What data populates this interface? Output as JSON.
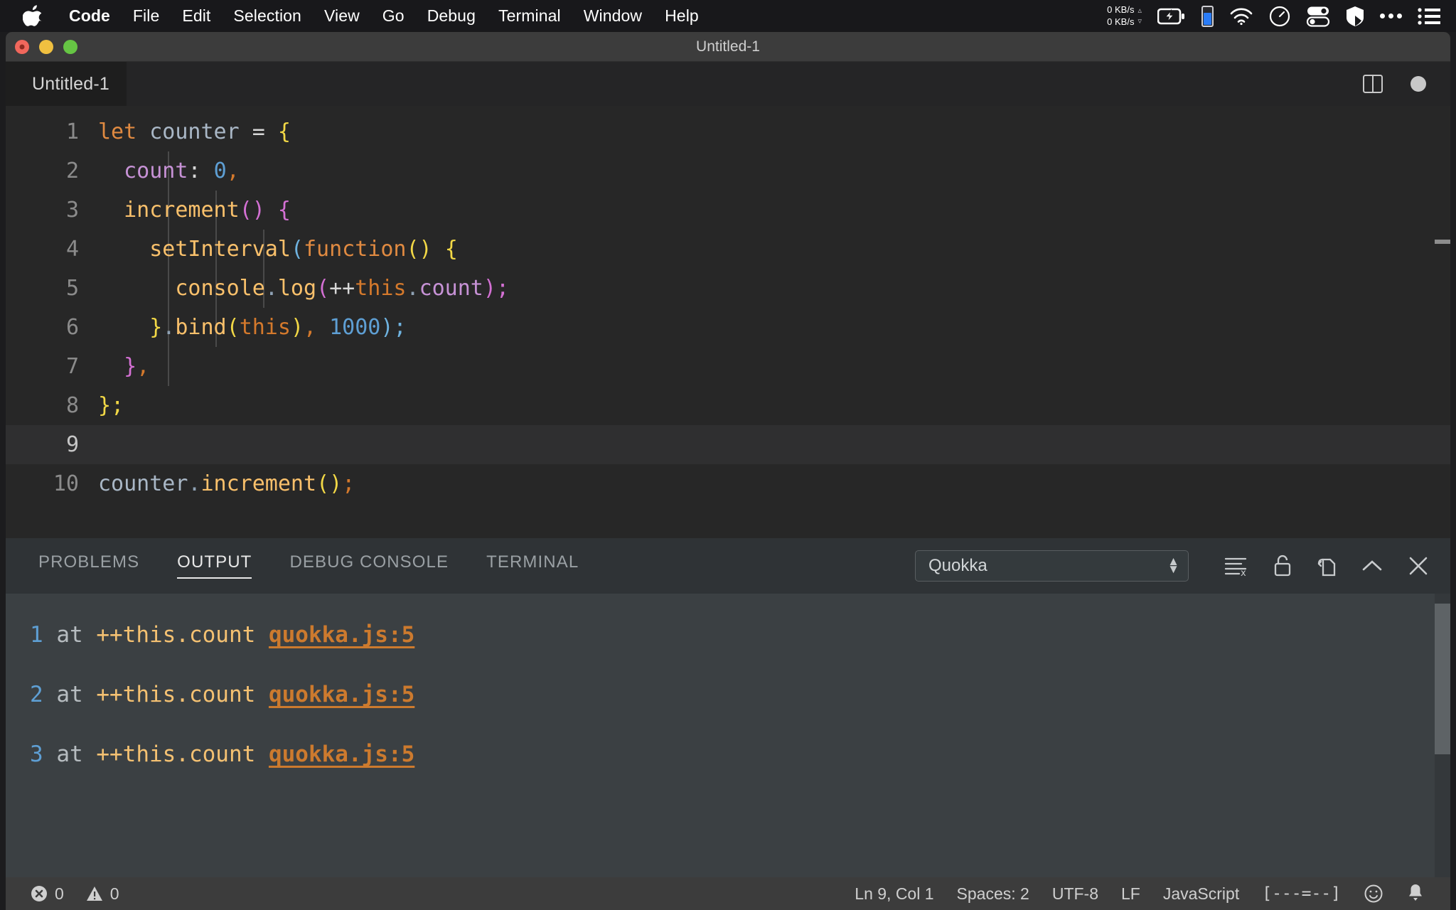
{
  "menubar": {
    "apple_icon": "apple-logo",
    "items": [
      {
        "label": "Code",
        "bold": true
      },
      {
        "label": "File",
        "bold": false
      },
      {
        "label": "Edit",
        "bold": false
      },
      {
        "label": "Selection",
        "bold": false
      },
      {
        "label": "View",
        "bold": false
      },
      {
        "label": "Go",
        "bold": false
      },
      {
        "label": "Debug",
        "bold": false
      },
      {
        "label": "Terminal",
        "bold": false
      },
      {
        "label": "Window",
        "bold": false
      },
      {
        "label": "Help",
        "bold": false
      }
    ],
    "status": {
      "net_up": "0 KB/s",
      "net_down": "0 KB/s",
      "up_arrow": "▵",
      "down_arrow": "▿",
      "icons": [
        "battery-charging-icon",
        "battery-level-icon",
        "wifi-icon",
        "speedometer-icon",
        "toggles-icon",
        "shield-icon",
        "ellipsis-icon",
        "list-menu-icon"
      ]
    }
  },
  "window": {
    "title": "Untitled-1",
    "controls": [
      "close-button",
      "minimize-button",
      "zoom-button"
    ]
  },
  "editor": {
    "tab_label": "Untitled-1",
    "actions": [
      "split-editor-icon",
      "unsaved-indicator-dot"
    ],
    "lines": [
      {
        "n": "1",
        "active": false,
        "tokens": [
          {
            "t": "let",
            "c": "t-kw"
          },
          {
            "t": " ",
            "c": "t-plain"
          },
          {
            "t": "counter",
            "c": "t-var"
          },
          {
            "t": " ",
            "c": "t-plain"
          },
          {
            "t": "=",
            "c": "t-punc"
          },
          {
            "t": " ",
            "c": "t-plain"
          },
          {
            "t": "{",
            "c": "t-br1"
          }
        ]
      },
      {
        "n": "2",
        "active": false,
        "tokens": [
          {
            "t": "  ",
            "c": "t-plain"
          },
          {
            "t": "count",
            "c": "t-prop"
          },
          {
            "t": ":",
            "c": "t-punc"
          },
          {
            "t": " ",
            "c": "t-plain"
          },
          {
            "t": "0",
            "c": "t-num"
          },
          {
            "t": ",",
            "c": "t-this"
          }
        ]
      },
      {
        "n": "3",
        "active": false,
        "tokens": [
          {
            "t": "  ",
            "c": "t-plain"
          },
          {
            "t": "increment",
            "c": "t-fn"
          },
          {
            "t": "()",
            "c": "t-br2"
          },
          {
            "t": " ",
            "c": "t-plain"
          },
          {
            "t": "{",
            "c": "t-br2"
          }
        ]
      },
      {
        "n": "4",
        "active": false,
        "tokens": [
          {
            "t": "    ",
            "c": "t-plain"
          },
          {
            "t": "setInterval",
            "c": "t-fn"
          },
          {
            "t": "(",
            "c": "t-br3"
          },
          {
            "t": "function",
            "c": "t-kw"
          },
          {
            "t": "()",
            "c": "t-br1"
          },
          {
            "t": " ",
            "c": "t-plain"
          },
          {
            "t": "{",
            "c": "t-br1"
          }
        ]
      },
      {
        "n": "5",
        "active": false,
        "tokens": [
          {
            "t": "      ",
            "c": "t-plain"
          },
          {
            "t": "console",
            "c": "t-fn"
          },
          {
            "t": ".",
            "c": "t-dot"
          },
          {
            "t": "log",
            "c": "t-fn"
          },
          {
            "t": "(",
            "c": "t-br2"
          },
          {
            "t": "++",
            "c": "t-punc"
          },
          {
            "t": "this",
            "c": "t-this"
          },
          {
            "t": ".",
            "c": "t-dot"
          },
          {
            "t": "count",
            "c": "t-prop"
          },
          {
            "t": ")",
            "c": "t-br2"
          },
          {
            "t": ";",
            "c": "t-br2"
          }
        ]
      },
      {
        "n": "6",
        "active": false,
        "tokens": [
          {
            "t": "    ",
            "c": "t-plain"
          },
          {
            "t": "}",
            "c": "t-br1"
          },
          {
            "t": ".",
            "c": "t-dot"
          },
          {
            "t": "bind",
            "c": "t-fn"
          },
          {
            "t": "(",
            "c": "t-br1"
          },
          {
            "t": "this",
            "c": "t-this"
          },
          {
            "t": ")",
            "c": "t-br1"
          },
          {
            "t": ",",
            "c": "t-this"
          },
          {
            "t": " ",
            "c": "t-plain"
          },
          {
            "t": "1000",
            "c": "t-num"
          },
          {
            "t": ")",
            "c": "t-br3"
          },
          {
            "t": ";",
            "c": "t-br3"
          }
        ]
      },
      {
        "n": "7",
        "active": false,
        "tokens": [
          {
            "t": "  ",
            "c": "t-plain"
          },
          {
            "t": "}",
            "c": "t-br2"
          },
          {
            "t": ",",
            "c": "t-this"
          }
        ]
      },
      {
        "n": "8",
        "active": false,
        "tokens": [
          {
            "t": "}",
            "c": "t-br1"
          },
          {
            "t": ";",
            "c": "t-br1"
          }
        ]
      },
      {
        "n": "9",
        "active": true,
        "tokens": []
      },
      {
        "n": "10",
        "active": false,
        "tokens": [
          {
            "t": "counter",
            "c": "t-var"
          },
          {
            "t": ".",
            "c": "t-dot"
          },
          {
            "t": "increment",
            "c": "t-fn"
          },
          {
            "t": "()",
            "c": "t-br1"
          },
          {
            "t": ";",
            "c": "t-this"
          }
        ]
      }
    ]
  },
  "panel": {
    "tabs": [
      {
        "label": "PROBLEMS",
        "active": false
      },
      {
        "label": "OUTPUT",
        "active": true
      },
      {
        "label": "DEBUG CONSOLE",
        "active": false
      },
      {
        "label": "TERMINAL",
        "active": false
      }
    ],
    "channel_select": {
      "value": "Quokka",
      "options": [
        "Quokka"
      ]
    },
    "actions": [
      "clear-output-icon",
      "lock-scroll-icon",
      "open-in-editor-icon",
      "maximize-panel-icon",
      "close-panel-icon"
    ],
    "output_lines": [
      {
        "num": "1",
        "at": "at",
        "expr": "++this.count",
        "link": "quokka.js:5"
      },
      {
        "num": "2",
        "at": "at",
        "expr": "++this.count",
        "link": "quokka.js:5"
      },
      {
        "num": "3",
        "at": "at",
        "expr": "++this.count",
        "link": "quokka.js:5"
      }
    ]
  },
  "statusbar": {
    "errors": "0",
    "warnings": "0",
    "cursor_position": "Ln 9, Col 1",
    "indentation": "Spaces: 2",
    "encoding": "UTF-8",
    "eol": "LF",
    "language": "JavaScript",
    "quokka_status": "[---=--]",
    "icons": [
      "error-icon",
      "warning-icon",
      "feedback-smiley-icon",
      "notifications-bell-icon"
    ]
  },
  "colors": {
    "accent_link": "#cc7a2e",
    "keyword": "#e08a41",
    "number": "#5e9fd4",
    "function": "#f9c06b",
    "property": "#c792d6",
    "this_keyword": "#d4792c"
  }
}
